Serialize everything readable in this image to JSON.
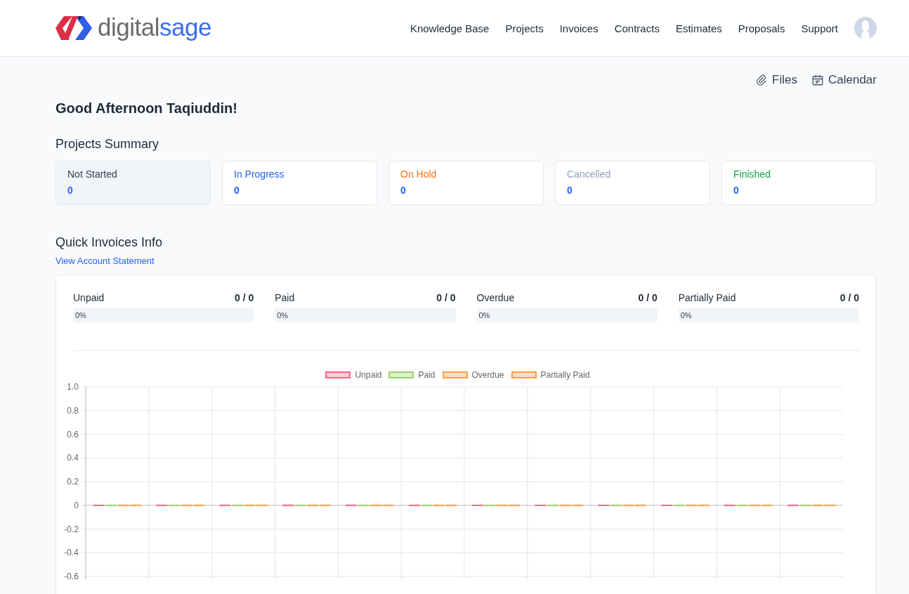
{
  "header": {
    "logo": {
      "part_1": "digital",
      "part_2": "sage"
    },
    "nav": [
      {
        "label": "Knowledge Base"
      },
      {
        "label": "Projects"
      },
      {
        "label": "Invoices"
      },
      {
        "label": "Contracts"
      },
      {
        "label": "Estimates"
      },
      {
        "label": "Proposals"
      },
      {
        "label": "Support"
      }
    ]
  },
  "quick_links": [
    {
      "kind": "files",
      "label": "Files"
    },
    {
      "kind": "calendar",
      "label": "Calendar"
    }
  ],
  "greeting": "Good Afternoon Taqiuddin!",
  "projects_summary": {
    "title": "Projects Summary",
    "cards": [
      {
        "label": "Not Started",
        "count": "0",
        "color": "#374151",
        "highlighted": true
      },
      {
        "label": "In Progress",
        "count": "0",
        "color": "#2563eb",
        "highlighted": false
      },
      {
        "label": "On Hold",
        "count": "0",
        "color": "#f97316",
        "highlighted": false
      },
      {
        "label": "Cancelled",
        "count": "0",
        "color": "#94a3b8",
        "highlighted": false
      },
      {
        "label": "Finished",
        "count": "0",
        "color": "#16a34a",
        "highlighted": false
      }
    ]
  },
  "quick_invoices": {
    "title": "Quick Invoices Info",
    "link": "View Account Statement",
    "stats": [
      {
        "label": "Unpaid",
        "total": "0 / 0",
        "percent": "0%",
        "level": 0
      },
      {
        "label": "Paid",
        "total": "0 / 0",
        "percent": "0%",
        "level": 0
      },
      {
        "label": "Overdue",
        "total": "0 / 0",
        "percent": "0%",
        "level": 0
      },
      {
        "label": "Partially Paid",
        "total": "0 / 0",
        "percent": "0%",
        "level": 0
      }
    ],
    "chart_data": {
      "type": "bar",
      "grid": true,
      "ylim": [
        -0.6,
        1.0
      ],
      "yticks": [
        {
          "value": 1.0,
          "label": "1.0"
        },
        {
          "value": 0.8,
          "label": "0.8"
        },
        {
          "value": 0.6,
          "label": "0.6"
        },
        {
          "value": 0.4,
          "label": "0.4"
        },
        {
          "value": 0.2,
          "label": "0.2"
        },
        {
          "value": 0,
          "label": "0"
        },
        {
          "value": -0.2,
          "label": "-0.2"
        },
        {
          "value": -0.4,
          "label": "-0.4"
        },
        {
          "value": -0.6,
          "label": "-0.6"
        }
      ],
      "series": [
        {
          "name": "Unpaid",
          "color": "#ff6384",
          "values": [
            0,
            0,
            0,
            0,
            0,
            0,
            0,
            0,
            0,
            0,
            0,
            0
          ]
        },
        {
          "name": "Paid",
          "color": "#9ccf6b",
          "values": [
            0,
            0,
            0,
            0,
            0,
            0,
            0,
            0,
            0,
            0,
            0,
            0
          ]
        },
        {
          "name": "Overdue",
          "color": "#ff9f40",
          "values": [
            0,
            0,
            0,
            0,
            0,
            0,
            0,
            0,
            0,
            0,
            0,
            0
          ]
        },
        {
          "name": "Partially Paid",
          "color": "#ff9f40",
          "values": [
            0,
            0,
            0,
            0,
            0,
            0,
            0,
            0,
            0,
            0,
            0,
            0
          ]
        }
      ]
    }
  }
}
